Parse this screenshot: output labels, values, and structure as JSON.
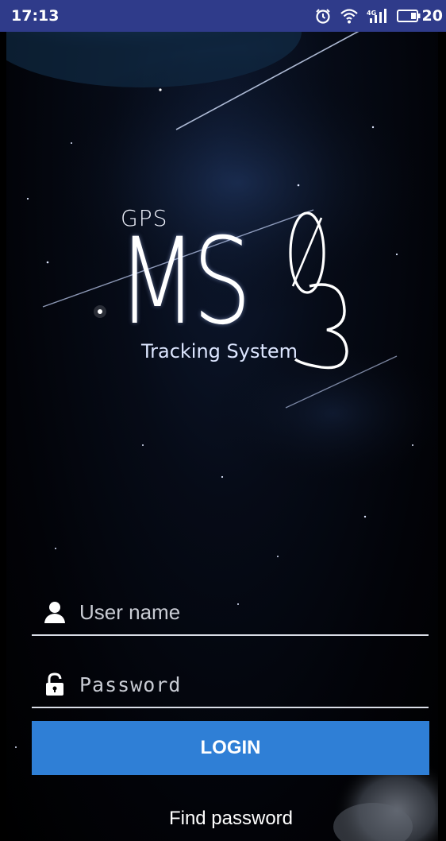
{
  "status_bar": {
    "time": "17:13",
    "battery_level": "20",
    "icons": [
      "alarm-icon",
      "wifi-icon",
      "signal-icon",
      "battery-icon"
    ],
    "background": "#2f3b8a"
  },
  "logo": {
    "top_text": "GPS",
    "main_letters": "MS",
    "digits": "03",
    "tagline": "Tracking System"
  },
  "form": {
    "username_placeholder": "User name",
    "password_placeholder": "Password",
    "login_label": "LOGIN",
    "find_password_label": "Find password",
    "accent_color": "#2f7fd6"
  }
}
